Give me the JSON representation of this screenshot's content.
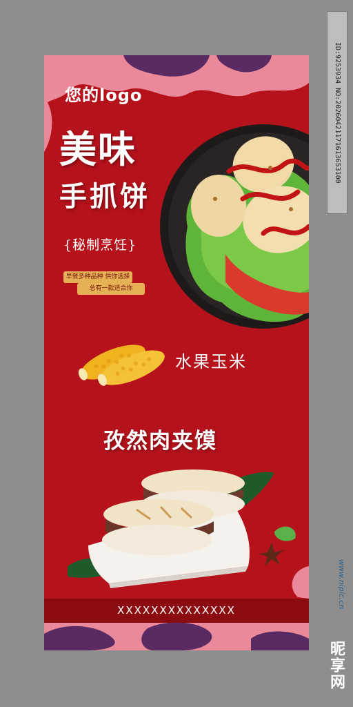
{
  "poster": {
    "logo_text": "您的logo",
    "title_line1": "美味",
    "title_line2": "手抓饼",
    "subtitle": "{秘制烹饪}",
    "pill1": "早餐多种品种 供你选择",
    "pill2": "总有一款适合你",
    "corn_label": "水果玉米",
    "sandwich_title": "孜然肉夹馍",
    "footer_text": "XXXXXXXXXXXXXX"
  },
  "side": {
    "id_text": "ID:9253934 NO:20260421171613653100",
    "watermark": "www.nipic.cn",
    "brand": "昵享网"
  },
  "colors": {
    "page_bg": "#8e8e8e",
    "poster_red": "#b5121b",
    "deco_pink": "#e9899a",
    "deco_purple": "#5a2a63",
    "pill_gold": "#e6b054",
    "footer_band": "#8a0c10"
  }
}
